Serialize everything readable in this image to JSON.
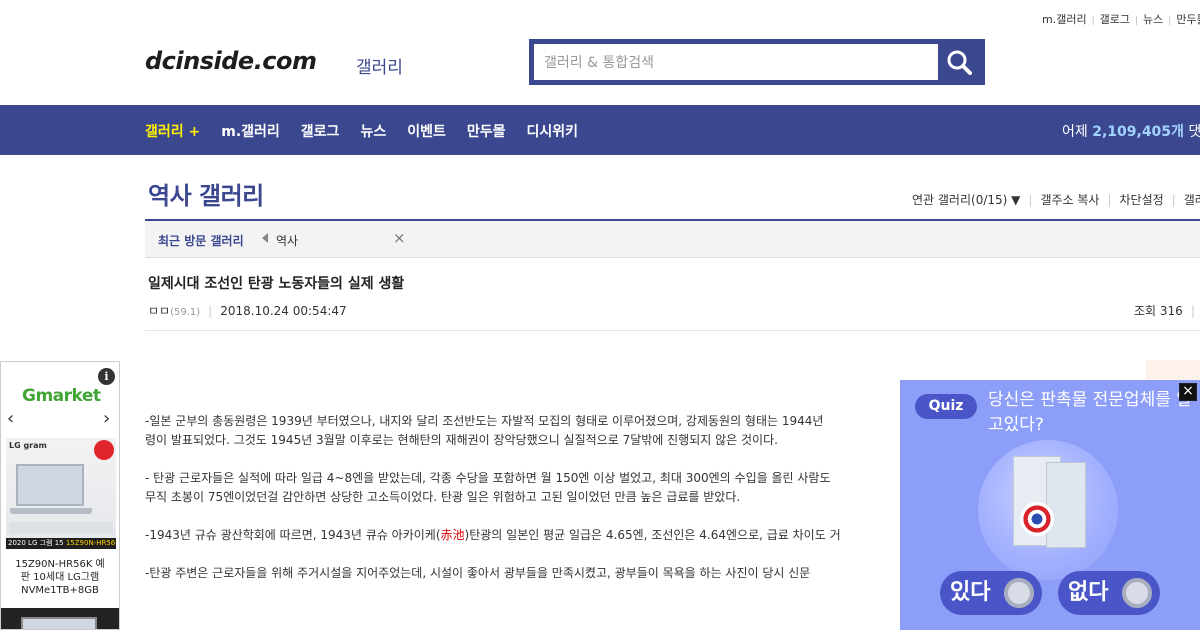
{
  "util_links": [
    "m.갤러리",
    "갤로그",
    "뉴스",
    "만두몰"
  ],
  "logo": {
    "text": "dcinside.com",
    "sub": "갤러리"
  },
  "search": {
    "placeholder": "갤러리 & 통합검색",
    "icon": "search-icon"
  },
  "nav": {
    "items": [
      "갤러리 +",
      "m.갤러리",
      "갤로그",
      "뉴스",
      "이벤트",
      "만두몰",
      "디시위키"
    ],
    "stat_prefix": "어제",
    "stat_value": "2,109,405개",
    "stat_suffix": "댓글"
  },
  "gallery": {
    "title": "역사 갤러리",
    "menu": [
      "연관 갤러리(0/15)",
      "갤주소 복사",
      "차단설정",
      "갤러"
    ]
  },
  "recent": {
    "label": "최근 방문 갤러리",
    "item": "역사",
    "close": "×"
  },
  "post": {
    "title": "일제시대 조선인 탄광 노동자들의 실제 생활",
    "author": "ㅁㅁ",
    "ip": "(59.1)",
    "date": "2018.10.24 00:54:47",
    "views": "조회 316",
    "paragraphs": [
      [
        "-일본 군부의 총동원령은 1939년 부터였으나, 내지와 달리 조선반도는 자발적 모집의 형태로 이루어졌으며, 강제동원의 형태는 1944년",
        "령이 발표되었다. 그것도 1945년 3월말 이후로는 현해탄의 재해권이 장악당했으니 실질적으로 7달밖에 진행되지 않은 것이다."
      ],
      [
        "- 탄광 근로자들은 실적에 따라 일급 4~8엔을 받았는데, 각종 수당을 포함하면 월 150엔 이상 벌었고, 최대 300엔의 수입을 올린 사람도",
        "무직 초봉이 75엔이었던걸 감안하면 상당한 고소득이었다. 탄광 일은 위험하고 고된 일이었던 만큼 높은 급료를 받았다."
      ],
      [
        "-1943년 규슈 광산학회에 따르면, 1943년 큐슈 아카이케(",
        "赤池",
        ")탄광의 일본인 평균 일급은 4.65엔, 조선인은 4.64엔으로, 급료 차이도 거"
      ],
      [
        "-탄광 주변은 근로자들을 위해 주거시설을 지어주었는데, 시설이 좋아서 광부들을 만족시켰고, 광부들이 목욕을 하는 사진이 당시 신문"
      ]
    ]
  },
  "ad": {
    "brand": "Gmarket",
    "product_brand": "LG gram",
    "banner_a": "2020 LG 그램 15 ",
    "banner_b": "15Z90N-HR56K",
    "caption": [
      "15Z90N-HR56K 예",
      "판 10세대 LG그램",
      "NVMe1TB+8GB"
    ],
    "info_icon": "info-icon"
  },
  "quiz": {
    "tag": "Quiz",
    "question": "당신은 판촉물 전문업체를 알고있다?",
    "yes": "있다",
    "no": "없다",
    "close": "×"
  },
  "colors": {
    "brand": "#3b4890",
    "nav_highlight": "#fff100",
    "stat": "#a3d4ff",
    "quiz_bg": "#8d9ef8"
  }
}
